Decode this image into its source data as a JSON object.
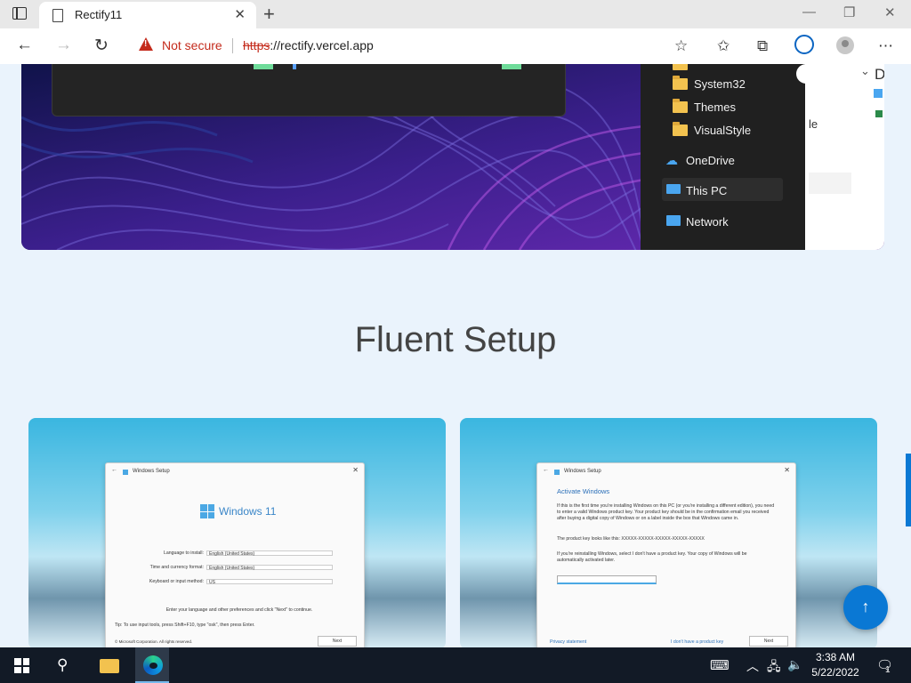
{
  "browser": {
    "tab": {
      "title": "Rectify11",
      "close_glyph": "✕"
    },
    "new_tab_glyph": "+",
    "window_controls": {
      "minimize": "—",
      "restore": "❐",
      "close": "✕"
    },
    "nav": {
      "back": "←",
      "forward": "→",
      "refresh": "↻"
    },
    "security_label": "Not secure",
    "url_protocol": "https",
    "url_rest": "://rectify.vercel.app",
    "toolbar_icons": [
      "favorite-add-icon",
      "favorites-icon",
      "collections-icon",
      "downloads-icon",
      "profile-icon",
      "more-icon"
    ],
    "more_glyph": "⋯"
  },
  "hero": {
    "explorer_items": [
      {
        "label": "System32",
        "icon": "folder-icon"
      },
      {
        "label": "Themes",
        "icon": "folder-icon"
      },
      {
        "label": "VisualStyle",
        "icon": "folder-icon"
      },
      {
        "label": "OneDrive",
        "icon": "cloud-icon"
      },
      {
        "label": "This PC",
        "icon": "pc-icon"
      },
      {
        "label": "Network",
        "icon": "network-icon"
      }
    ],
    "right_partial_letter": "D",
    "right_partial_text": "le"
  },
  "section": {
    "title": "Fluent Setup"
  },
  "card1": {
    "window_title": "Windows Setup",
    "logo_text": "Windows 11",
    "fields": [
      {
        "label": "Language to install:",
        "value": "English (United States)"
      },
      {
        "label": "Time and currency format:",
        "value": "English (United States)"
      },
      {
        "label": "Keyboard or input method:",
        "value": "US"
      }
    ],
    "hint": "Enter your language and other preferences and click \"Next\" to continue.",
    "tip": "Tip: To use input tools, press Shift+F10, type \"osk\", then press Enter.",
    "copyright": "© Microsoft Corporation. All rights reserved.",
    "next_label": "Next"
  },
  "card2": {
    "window_title": "Windows Setup",
    "heading": "Activate Windows",
    "para1": "If this is the first time you're installing Windows on this PC (or you're installing a different edition), you need to enter a valid Windows product key. Your product key should be in the confirmation email you received after buying a digital copy of Windows or on a label inside the box that Windows came in.",
    "para2": "The product key looks like this: XXXXX-XXXXX-XXXXX-XXXXX-XXXXX",
    "para3": "If you're reinstalling Windows, select I don't have a product key. Your copy of Windows will be automatically activated later.",
    "privacy_link": "Privacy statement",
    "no_key_link": "I don't have a product key",
    "next_label": "Next"
  },
  "fab_glyph": "↑",
  "taskbar": {
    "time": "3:38 AM",
    "date": "5/22/2022",
    "notification_count": "1",
    "tray_icons": [
      "keyboard-icon",
      "chevron-up-icon",
      "network-icon",
      "volume-icon",
      "notifications-icon"
    ]
  },
  "colors": {
    "accent": "#0a78d4",
    "warning": "#c42b1c",
    "page_bg": "#eaf3fc",
    "taskbar": "#121a26"
  }
}
